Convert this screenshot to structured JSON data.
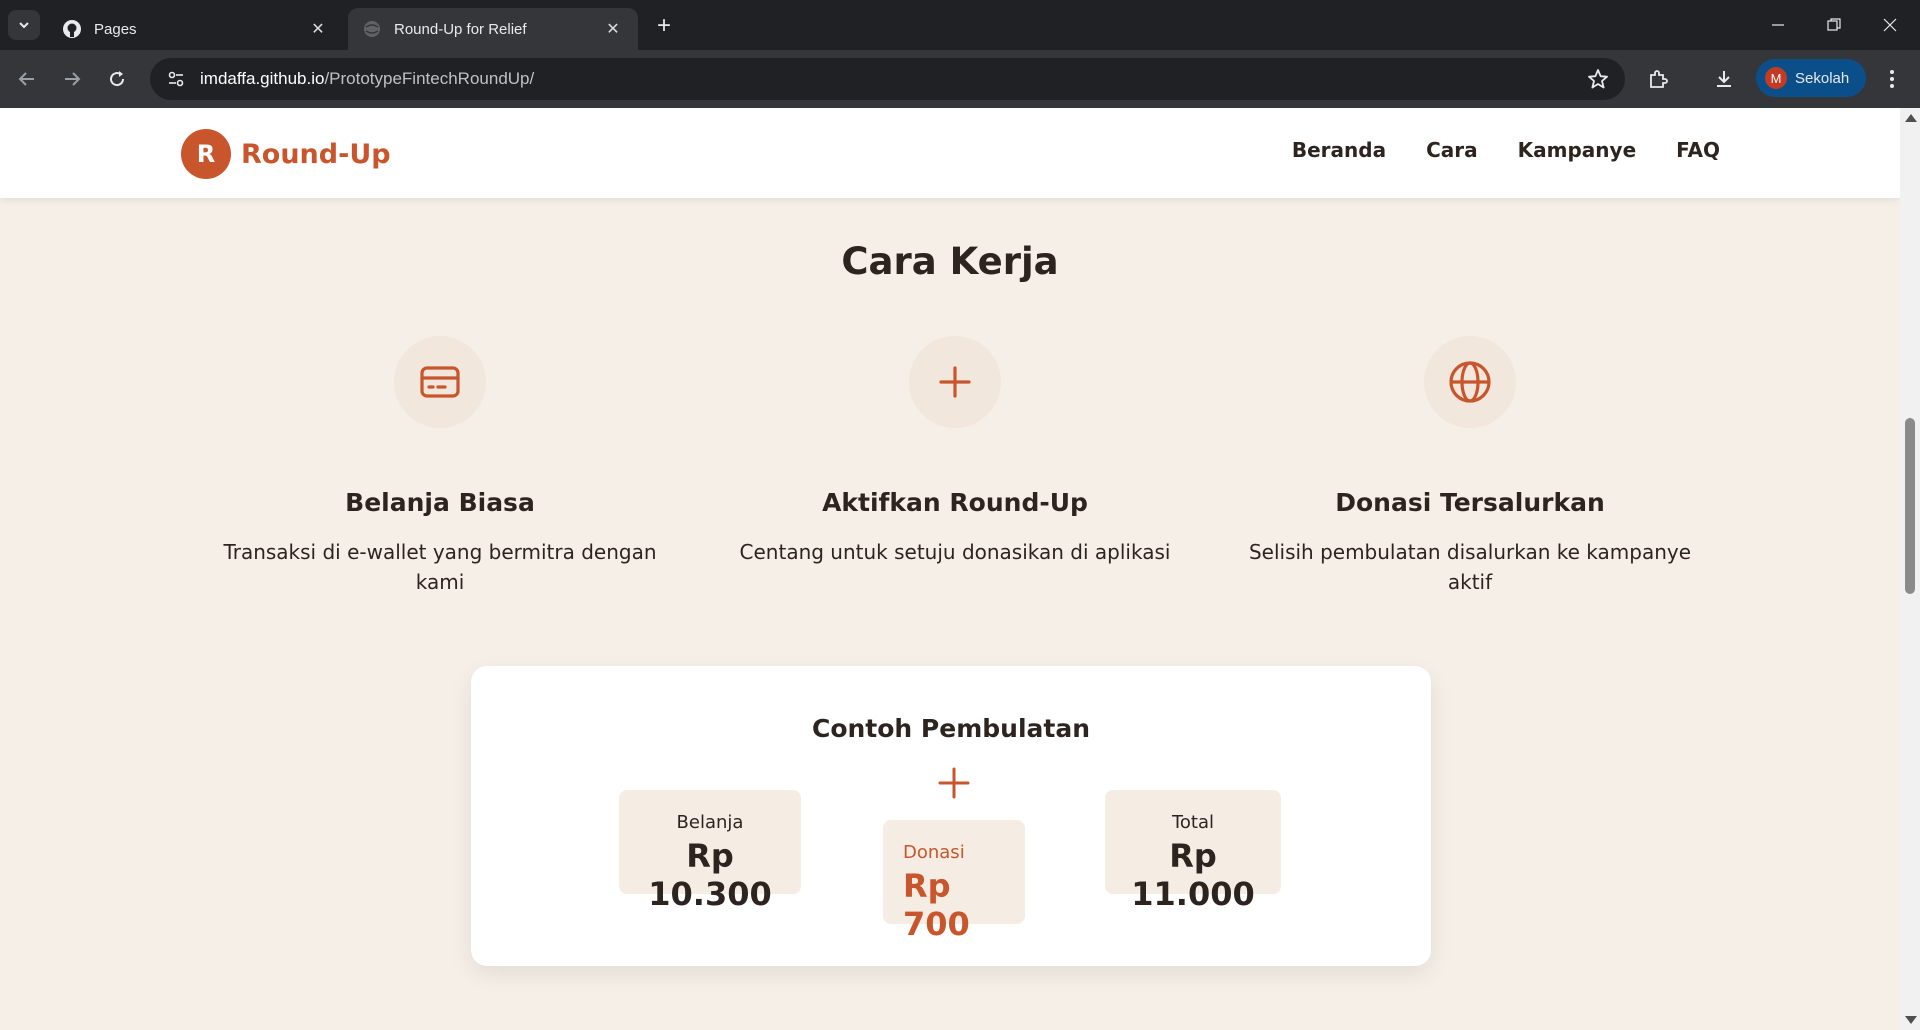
{
  "browser": {
    "tabs": [
      {
        "title": "Pages",
        "active": false
      },
      {
        "title": "Round-Up for Relief",
        "active": true
      }
    ],
    "url": {
      "host": "imdaffa.github.io",
      "path": "/PrototypeFintechRoundUp/"
    },
    "profile": {
      "initial": "M",
      "name": "Sekolah"
    }
  },
  "site": {
    "logo": {
      "badge": "R",
      "name": "Round-Up"
    },
    "nav": [
      "Beranda",
      "Cara",
      "Kampanye",
      "FAQ"
    ]
  },
  "how_it_works": {
    "title": "Cara Kerja",
    "steps": [
      {
        "icon": "credit-card-icon",
        "title": "Belanja Biasa",
        "desc": "Transaksi di e-wallet yang bermitra dengan kami"
      },
      {
        "icon": "plus-icon",
        "title": "Aktifkan Round-Up",
        "desc": "Centang untuk setuju donasikan di aplikasi"
      },
      {
        "icon": "globe-icon",
        "title": "Donasi Tersalurkan",
        "desc": "Selisih pembulatan disalurkan ke kampanye aktif"
      }
    ]
  },
  "example": {
    "title": "Contoh Pembulatan",
    "belanja": {
      "label": "Belanja",
      "amount": "Rp 10.300"
    },
    "donasi": {
      "label": "Donasi",
      "amount": "Rp 700"
    },
    "total": {
      "label": "Total",
      "amount": "Rp 11.000"
    }
  },
  "colors": {
    "accent": "#c8552b",
    "background": "#f5efe7",
    "text": "#2d2420"
  }
}
